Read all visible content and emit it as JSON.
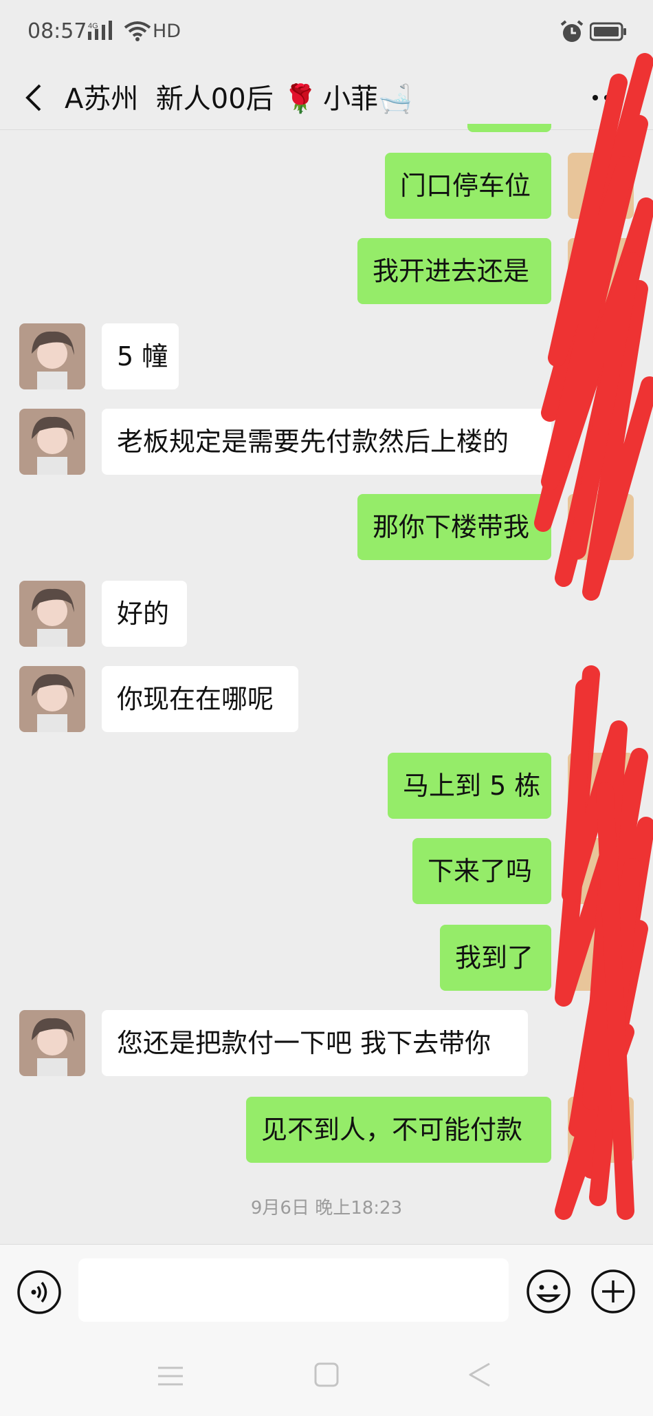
{
  "status_bar": {
    "time": "08:57",
    "network": "4G",
    "hd": "HD"
  },
  "header": {
    "title": "A苏州  新人00后",
    "name_suffix": "小菲",
    "rose_emoji": "🌹",
    "bath_emoji": "🛁"
  },
  "messages": [
    {
      "direction": "out",
      "text": "门口停车位"
    },
    {
      "direction": "out",
      "text": "我开进去还是"
    },
    {
      "direction": "in",
      "text": "5 幢"
    },
    {
      "direction": "in",
      "text": "老板规定是需要先付款然后上楼的"
    },
    {
      "direction": "out",
      "text": "那你下楼带我"
    },
    {
      "direction": "in",
      "text": "好的"
    },
    {
      "direction": "in",
      "text": "你现在在哪呢"
    },
    {
      "direction": "out",
      "text": "马上到 5 栋"
    },
    {
      "direction": "out",
      "text": "下来了吗"
    },
    {
      "direction": "out",
      "text": "我到了"
    },
    {
      "direction": "in",
      "text": "您还是把款付一下吧 我下去带你"
    },
    {
      "direction": "out",
      "text": "见不到人，不可能付款"
    }
  ],
  "timestamp": "9月6日 晚上18:23",
  "input": {
    "value": "",
    "placeholder": ""
  },
  "icons": {
    "back": "chevron-left-icon",
    "more": "more-icon",
    "voice": "voice-icon",
    "emoji": "emoji-icon",
    "plus": "plus-icon"
  },
  "colors": {
    "outgoing_bubble": "#95ec69",
    "incoming_bubble": "#ffffff",
    "background": "#ededed",
    "scribble": "#ee3333"
  }
}
